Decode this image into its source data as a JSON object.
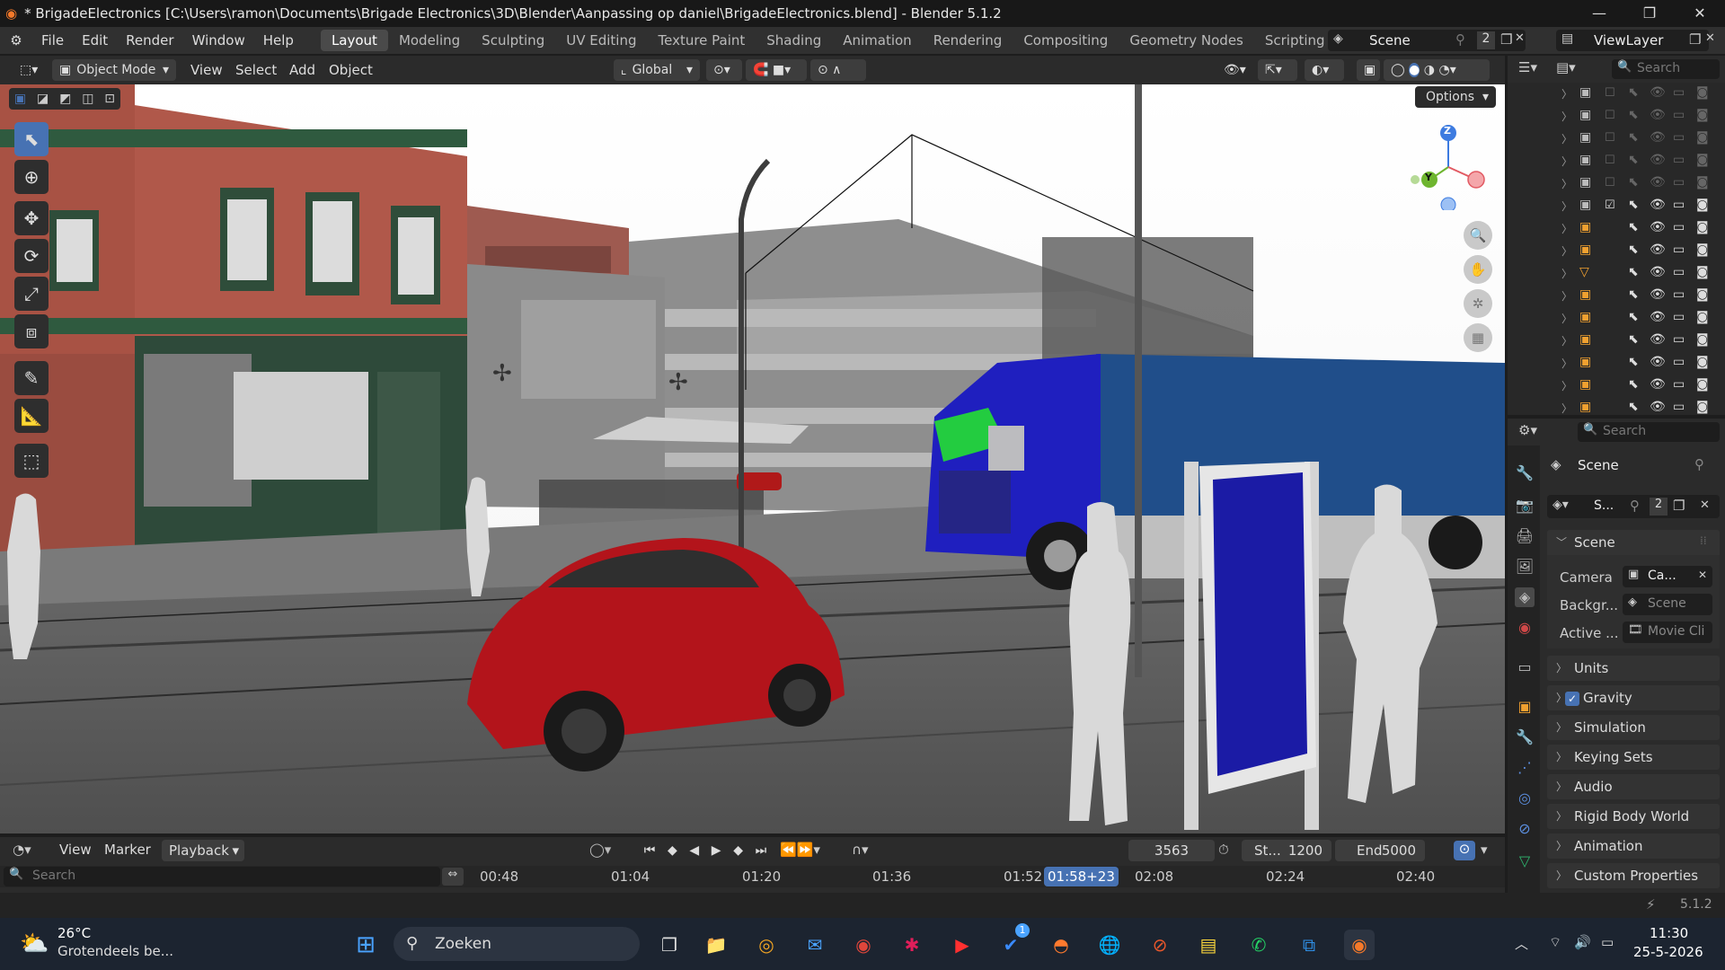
{
  "window": {
    "title": "* BrigadeElectronics [C:\\Users\\ramon\\Documents\\Brigade Electronics\\3D\\Blender\\Aanpassing op daniel\\BrigadeElectronics.blend] - Blender 5.1.2",
    "minimize": "—",
    "maximize": "❐",
    "close": "✕"
  },
  "menu": [
    "File",
    "Edit",
    "Render",
    "Window",
    "Help"
  ],
  "workspaces": [
    "Layout",
    "Modeling",
    "Sculpting",
    "UV Editing",
    "Texture Paint",
    "Shading",
    "Animation",
    "Rendering",
    "Compositing",
    "Geometry Nodes",
    "Scripting"
  ],
  "active_workspace": "Layout",
  "add_workspace": "+",
  "scene_selector": {
    "label": "Scene",
    "users": "2"
  },
  "viewlayer_selector": {
    "label": "ViewLayer"
  },
  "viewport_header": {
    "mode": "Object Mode",
    "menus": [
      "View",
      "Select",
      "Add",
      "Object"
    ],
    "orientation": "Global",
    "options": "Options"
  },
  "gizmo": {
    "z": "Z",
    "y": "Y"
  },
  "outliner": {
    "search_placeholder": "Search"
  },
  "properties": {
    "search_placeholder": "Search",
    "scene_title": "Scene",
    "datablock_name": "S...",
    "datablock_users": "2",
    "section_scene": "Scene",
    "fields": [
      {
        "label": "Camera",
        "value": "Ca..."
      },
      {
        "label": "Backgr...",
        "value": "Scene"
      },
      {
        "label": "Active ...",
        "value": "Movie Cli"
      }
    ],
    "panels": [
      "Units",
      "Gravity",
      "Simulation",
      "Keying Sets",
      "Audio",
      "Rigid Body World",
      "Animation",
      "Custom Properties"
    ],
    "gravity_checked": true
  },
  "timeline": {
    "menus": [
      "View",
      "Marker",
      "Playback"
    ],
    "current_frame": "3563",
    "start_label": "St...",
    "start_value": "1200",
    "end_label": "End",
    "end_value": "5000",
    "search_placeholder": "Search",
    "ticks": [
      "00:48",
      "01:04",
      "01:20",
      "01:36",
      "01:52",
      "02:08",
      "02:24",
      "02:40"
    ],
    "playhead": "01:58+23"
  },
  "status": {
    "version": "5.1.2"
  },
  "taskbar": {
    "weather_temp": "26°C",
    "weather_desc": "Grotendeels be...",
    "search_label": "Zoeken",
    "time": "11:30",
    "date": "25-5-2026",
    "notification_badge": "1"
  },
  "colors": {
    "accent": "#4772b3",
    "truck_blue": "#1f1fbf",
    "car_red": "#b3141b",
    "facade_red": "#b0584a"
  }
}
